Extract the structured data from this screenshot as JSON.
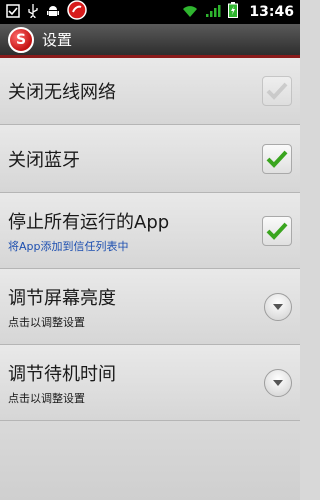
{
  "status_bar": {
    "time": "13:46"
  },
  "title_bar": {
    "title": "设置"
  },
  "settings": [
    {
      "title": "关闭无线网络",
      "subtitle": "",
      "control": "checkbox",
      "checked": true,
      "enabled": false
    },
    {
      "title": "关闭蓝牙",
      "subtitle": "",
      "control": "checkbox",
      "checked": true,
      "enabled": true
    },
    {
      "title": "停止所有运行的App",
      "subtitle": "将App添加到信任列表中",
      "control": "checkbox",
      "checked": true,
      "enabled": true
    },
    {
      "title": "调节屏幕亮度",
      "subtitle": "点击以调整设置",
      "control": "dropdown"
    },
    {
      "title": "调节待机时间",
      "subtitle": "点击以调整设置",
      "control": "dropdown"
    }
  ],
  "colors": {
    "accent_check": "#3aa51f",
    "link_blue": "#1d4fb0",
    "title_underline": "#8a1b1b"
  }
}
